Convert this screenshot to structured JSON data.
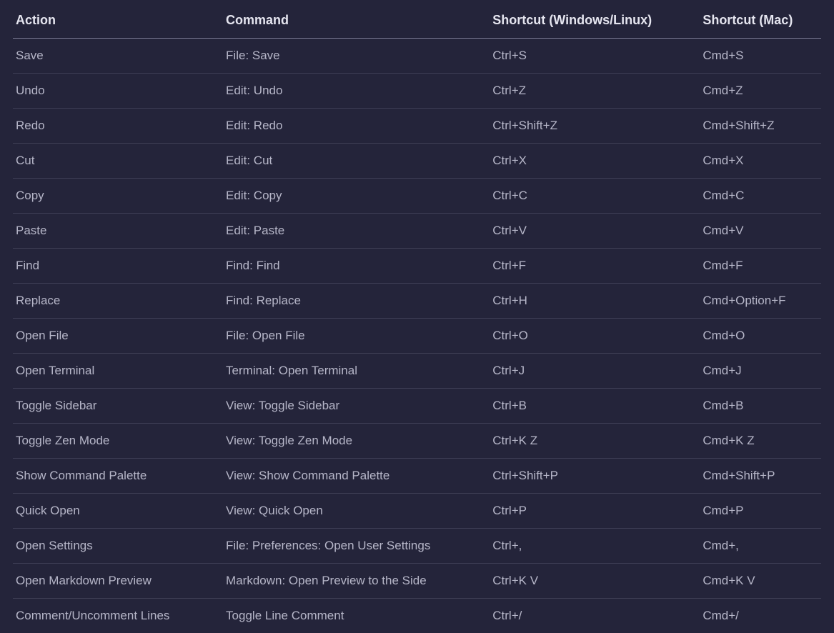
{
  "headers": {
    "action": "Action",
    "command": "Command",
    "shortcut_win": "Shortcut (Windows/Linux)",
    "shortcut_mac": "Shortcut (Mac)"
  },
  "rows": [
    {
      "action": "Save",
      "command": "File: Save",
      "win": "Ctrl+S",
      "mac": "Cmd+S"
    },
    {
      "action": "Undo",
      "command": "Edit: Undo",
      "win": "Ctrl+Z",
      "mac": "Cmd+Z"
    },
    {
      "action": "Redo",
      "command": "Edit: Redo",
      "win": "Ctrl+Shift+Z",
      "mac": "Cmd+Shift+Z"
    },
    {
      "action": "Cut",
      "command": "Edit: Cut",
      "win": "Ctrl+X",
      "mac": "Cmd+X"
    },
    {
      "action": "Copy",
      "command": "Edit: Copy",
      "win": "Ctrl+C",
      "mac": "Cmd+C"
    },
    {
      "action": "Paste",
      "command": "Edit: Paste",
      "win": "Ctrl+V",
      "mac": "Cmd+V"
    },
    {
      "action": "Find",
      "command": "Find: Find",
      "win": "Ctrl+F",
      "mac": "Cmd+F"
    },
    {
      "action": "Replace",
      "command": "Find: Replace",
      "win": "Ctrl+H",
      "mac": "Cmd+Option+F"
    },
    {
      "action": "Open File",
      "command": "File: Open File",
      "win": "Ctrl+O",
      "mac": "Cmd+O"
    },
    {
      "action": "Open Terminal",
      "command": "Terminal: Open Terminal",
      "win": "Ctrl+J",
      "mac": "Cmd+J"
    },
    {
      "action": "Toggle Sidebar",
      "command": "View: Toggle Sidebar",
      "win": "Ctrl+B",
      "mac": "Cmd+B"
    },
    {
      "action": "Toggle Zen Mode",
      "command": "View: Toggle Zen Mode",
      "win": "Ctrl+K Z",
      "mac": "Cmd+K Z"
    },
    {
      "action": "Show Command Palette",
      "command": "View: Show Command Palette",
      "win": "Ctrl+Shift+P",
      "mac": "Cmd+Shift+P"
    },
    {
      "action": "Quick Open",
      "command": "View: Quick Open",
      "win": "Ctrl+P",
      "mac": "Cmd+P"
    },
    {
      "action": "Open Settings",
      "command": "File: Preferences: Open User Settings",
      "win": "Ctrl+,",
      "mac": "Cmd+,"
    },
    {
      "action": "Open Markdown Preview",
      "command": "Markdown: Open Preview to the Side",
      "win": "Ctrl+K V",
      "mac": "Cmd+K V"
    },
    {
      "action": "Comment/Uncomment Lines",
      "command": "Toggle Line Comment",
      "win": "Ctrl+/",
      "mac": "Cmd+/"
    }
  ]
}
